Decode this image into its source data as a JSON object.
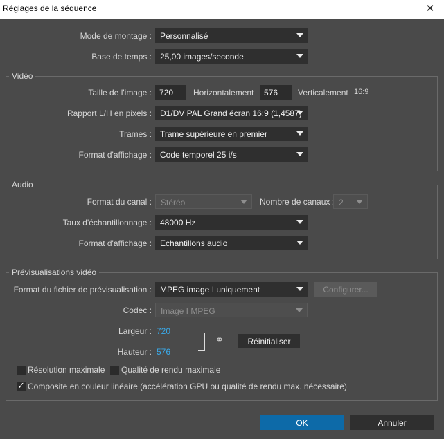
{
  "window": {
    "title": "Réglages de la séquence",
    "close_glyph": "✕"
  },
  "top": {
    "editing_mode_label": "Mode de montage :",
    "editing_mode_value": "Personnalisé",
    "timebase_label": "Base de temps :",
    "timebase_value": "25,00 images/seconde"
  },
  "video": {
    "group_title": "Vidéo",
    "frame_size_label": "Taille de l'image :",
    "width_value": "720",
    "horizontal_label": "Horizontalement",
    "height_value": "576",
    "vertical_label": "Verticalement",
    "aspect_ratio": "16:9",
    "pixel_aspect_label": "Rapport L/H en pixels :",
    "pixel_aspect_value": "D1/DV PAL Grand écran 16:9 (1,4587)",
    "fields_label": "Trames :",
    "fields_value": "Trame supérieure en premier",
    "display_format_label": "Format d'affichage :",
    "display_format_value": "Code temporel 25 i/s"
  },
  "audio": {
    "group_title": "Audio",
    "channel_format_label": "Format du canal :",
    "channel_format_value": "Stéréo",
    "num_channels_label": "Nombre de canaux :",
    "num_channels_value": "2",
    "sample_rate_label": "Taux d'échantillonnage :",
    "sample_rate_value": "48000 Hz",
    "display_format_label": "Format d'affichage :",
    "display_format_value": "Echantillons audio"
  },
  "preview": {
    "group_title": "Prévisualisations vidéo",
    "file_format_label": "Format du fichier de prévisualisation :",
    "file_format_value": "MPEG image I uniquement",
    "configure_label": "Configurer...",
    "codec_label": "Codec :",
    "codec_value": "Image I MPEG",
    "width_label": "Largeur :",
    "width_value": "720",
    "height_label": "Hauteur :",
    "height_value": "576",
    "link_glyph": "⚭",
    "reset_label": "Réinitialiser",
    "max_resolution_label": "Résolution maximale",
    "max_render_quality_label": "Qualité de rendu maximale",
    "linear_color_label": "Composite en couleur linéaire (accélération GPU ou qualité de rendu max. nécessaire)",
    "max_resolution_checked": false,
    "max_render_quality_checked": false,
    "linear_color_checked": true
  },
  "footer": {
    "ok_label": "OK",
    "cancel_label": "Annuler"
  },
  "colors": {
    "ok_button": "#0d6aa8",
    "value_blue": "#3aa9e8",
    "background": "#4a4a4a"
  }
}
